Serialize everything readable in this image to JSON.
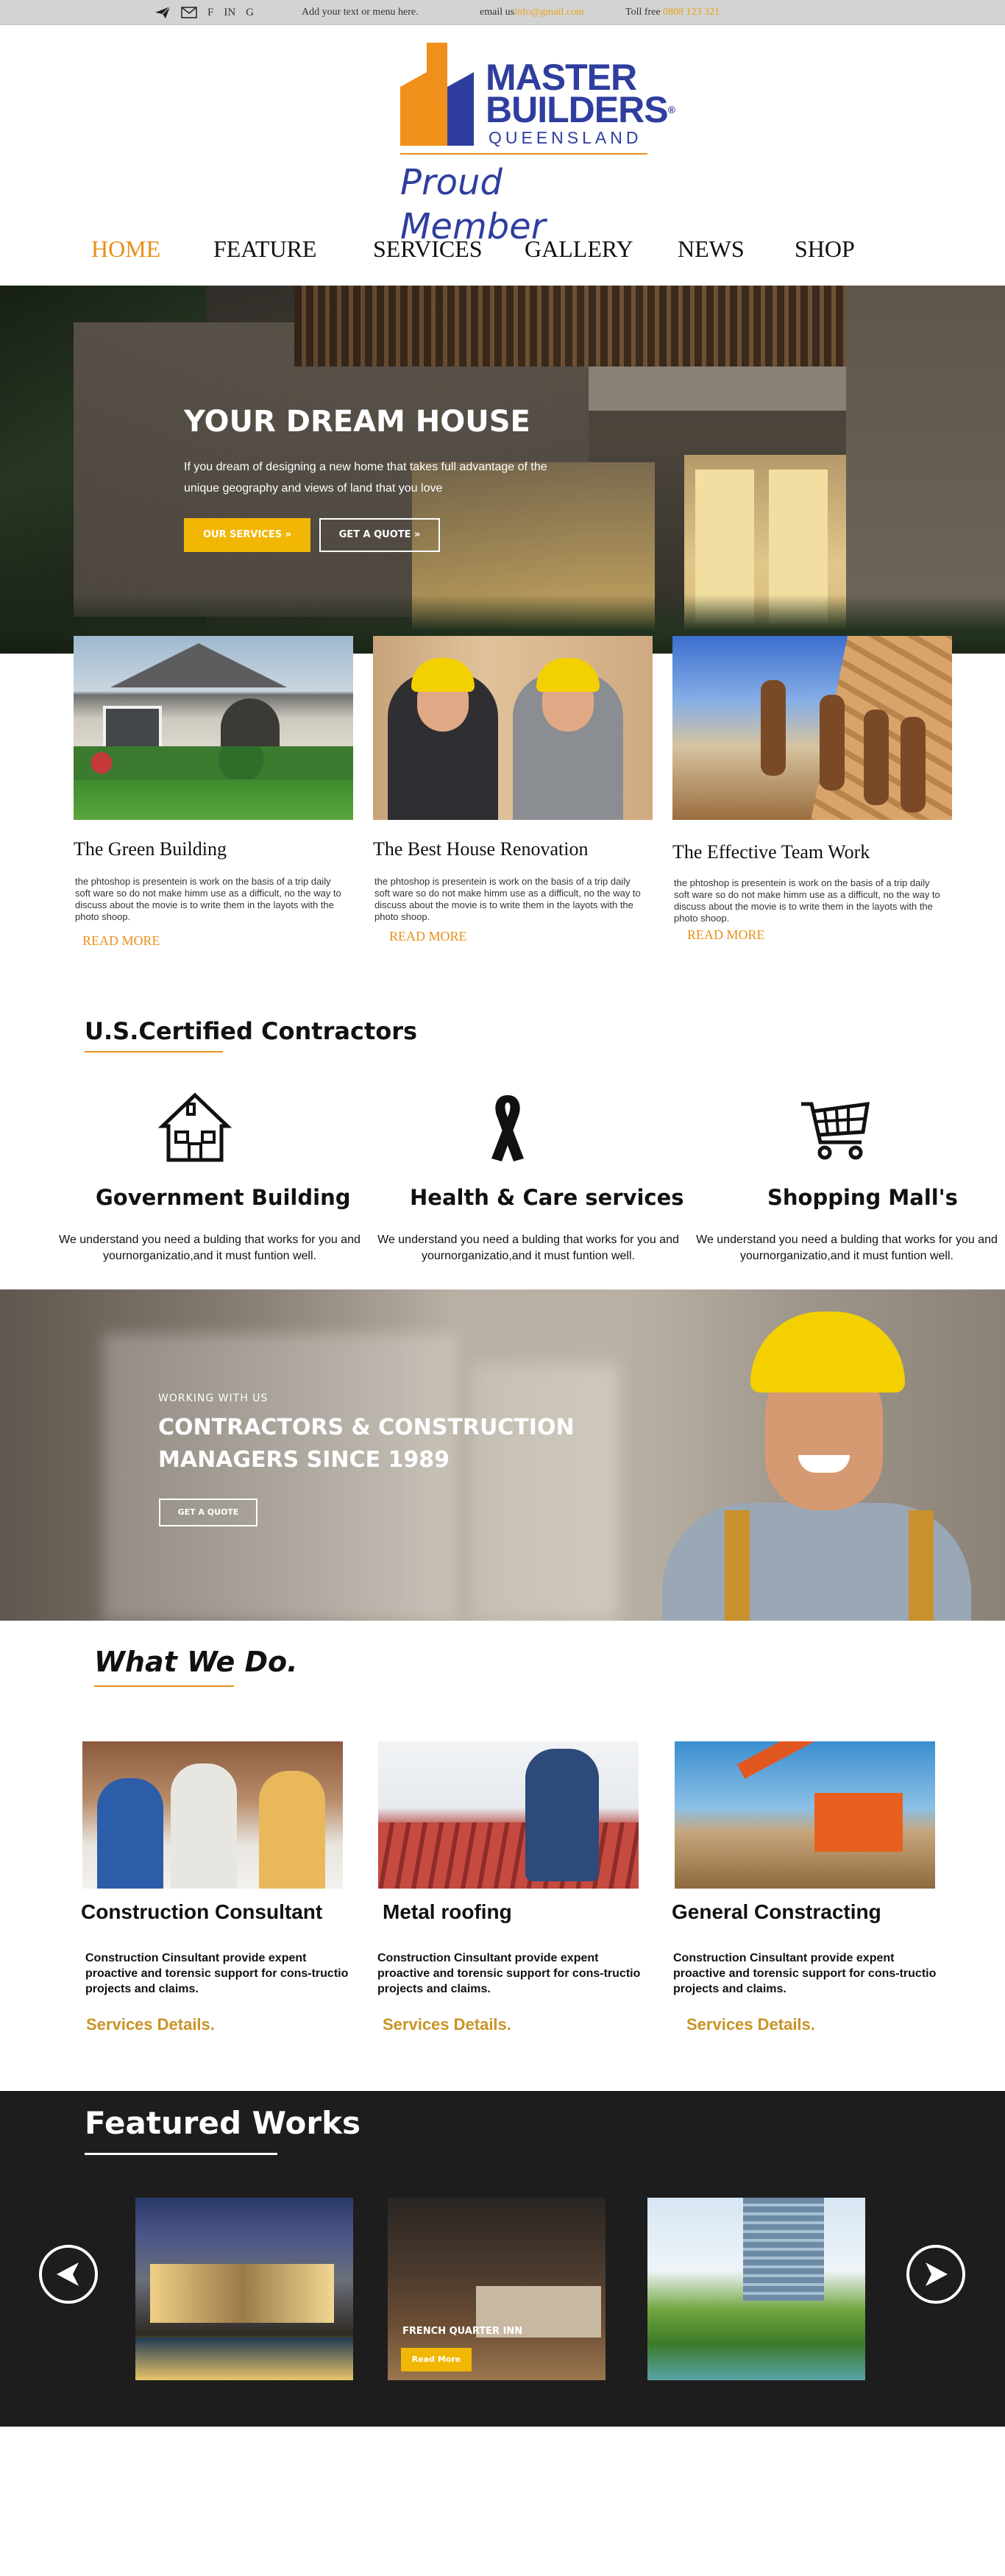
{
  "topbar": {
    "social_icons": [
      "plane-icon",
      "mail-icon",
      "F",
      "IN",
      "G"
    ],
    "menu_text": "Add your text or menu here.",
    "email_label": "email us",
    "email_value": "info@gmail.com",
    "toll_label": "Toll free",
    "toll_value": "0808 123 321"
  },
  "logo": {
    "line1": "MASTER",
    "line2": "BUILDERS",
    "registered": "®",
    "line3": "QUEENSLAND",
    "tagline": "Proud Member"
  },
  "nav": {
    "items": [
      {
        "label": "HOME",
        "active": true
      },
      {
        "label": "FEATURE",
        "active": false
      },
      {
        "label": "SERVICES",
        "active": false
      },
      {
        "label": "GALLERY",
        "active": false
      },
      {
        "label": "NEWS",
        "active": false
      },
      {
        "label": "SHOP",
        "active": false
      }
    ]
  },
  "hero": {
    "title": "YOUR DREAM HOUSE",
    "desc": "If you dream of designing a new home that takes full advantage of the unique geography and views of land that you love",
    "primary_button": "OUR SERVICES »",
    "secondary_button": "GET A QUOTE »"
  },
  "features": [
    {
      "title": "The Green Building",
      "text": "the phtoshop is presentein is work on the basis of a trip daily soft ware so do not make himm use as a difficult, no the way to discuss about the movie is to write them in the layots with the photo shoop.",
      "link": "READ MORE"
    },
    {
      "title": "The Best House Renovation",
      "text": "the phtoshop is presentein is work on the basis of a trip daily soft ware so do not make himm use as a difficult, no the way to discuss about the movie is to write them in the layots with the photo shoop.",
      "link": "READ MORE"
    },
    {
      "title": "The Effective Team Work",
      "text": "the phtoshop is presentein is work on the basis of a trip daily soft ware so do not make himm use as a difficult, no the way to discuss about the movie is to write them in the layots with the photo shoop.",
      "link": "READ MORE"
    }
  ],
  "certified": {
    "title": "U.S.Certified Contractors",
    "items": [
      {
        "icon": "house-icon",
        "title": "Government Building",
        "desc": "We understand you need a bulding that works for you and yournorganizatio,and it must funtion well."
      },
      {
        "icon": "ribbon-icon",
        "title": "Health & Care services",
        "desc": "We understand you need a bulding that works for you and yournorganizatio,and it must funtion well."
      },
      {
        "icon": "shopping-cart-icon",
        "title": "Shopping Mall's",
        "desc": "We understand you need a bulding that works for you and yournorganizatio,and it must funtion well."
      }
    ]
  },
  "banner": {
    "kicker": "WORKING WITH US",
    "title": "CONTRACTORS & CONSTRUCTION MANAGERS SINCE 1989",
    "button": "GET A QUOTE"
  },
  "what_we_do": {
    "title": "What We Do.",
    "items": [
      {
        "title": "Construction Consultant",
        "desc": "Construction Cinsultant provide expent proactive and torensic support for cons-tructio projects and claims.",
        "link": "Services Details."
      },
      {
        "title": "Metal roofing",
        "desc": "Construction Cinsultant provide expent proactive and torensic support for cons-tructio projects and claims.",
        "link": "Services Details."
      },
      {
        "title": "General Constracting",
        "desc": "Construction Cinsultant provide expent proactive and torensic support for cons-tructio projects and claims.",
        "link": "Services Details."
      }
    ]
  },
  "featured": {
    "title": "Featured Works",
    "caption": "FRENCH QUARTER INN",
    "button": "Read More",
    "prev_icon": "arrow-left-icon",
    "next_icon": "arrow-right-icon"
  },
  "colors": {
    "accent": "#e8901a",
    "yellow": "#f2b705",
    "brand_blue": "#2f3e9e",
    "dark_section": "#1d1d1d",
    "gold_link": "#c99328"
  }
}
